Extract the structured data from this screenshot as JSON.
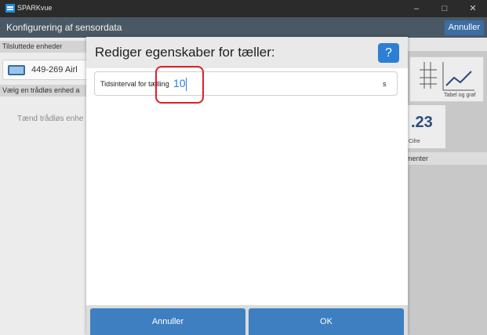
{
  "window": {
    "app_title": "SPARKvue",
    "min_glyph": "–",
    "max_glyph": "□",
    "close_glyph": "✕"
  },
  "appbar": {
    "title": "Konfigurering af sensordata",
    "cancel_label": "Annuller"
  },
  "background": {
    "connected_label": "Tilsluttede enheder",
    "sensor_name": "449-269 Airl",
    "wireless_label": "Vælg en trådløs enhed a",
    "wireless_message": "Tænd trådløs enhe",
    "graph_tile_label": "Tabel og graf",
    "digits_value": ".23",
    "digits_label": "Cifre",
    "comments_label": "menter"
  },
  "dialog": {
    "title": "Rediger egenskaber for tæller:",
    "help_label": "?",
    "field": {
      "label": "Tidsinterval for tælling",
      "value": "10",
      "unit": "s"
    },
    "cancel_label": "Annuller",
    "ok_label": "OK"
  },
  "colors": {
    "accent": "#2d7fd3",
    "button": "#3d7fc1",
    "highlight": "#e0202a",
    "header": "#4a5865"
  }
}
